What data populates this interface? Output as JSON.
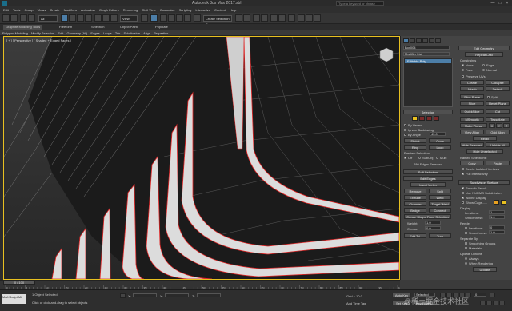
{
  "title_bar": {
    "title": "Autodesk 3ds Max 2017.sbl",
    "extra": "Type a keyword or phrase",
    "window_controls": [
      "—",
      "□",
      "×"
    ]
  },
  "menu": [
    "Edit",
    "Tools",
    "Group",
    "Views",
    "Create",
    "Modifiers",
    "Animation",
    "Graph Editors",
    "Rendering",
    "Civil View",
    "Customize",
    "Scripting",
    "Interactive",
    "Content",
    "Help"
  ],
  "main_toolbar": {
    "selection_filter": "All",
    "reference_coord": "View",
    "named_set": "Create Selection Se"
  },
  "ribbon_tabs": [
    {
      "label": "Graphite Modeling Tools",
      "active": true
    },
    {
      "label": "Freeform",
      "active": false
    },
    {
      "label": "Selection",
      "active": false
    },
    {
      "label": "Object Paint",
      "active": false
    },
    {
      "label": "Populate",
      "active": false
    }
  ],
  "ribbon_items": [
    "Polygon Modeling",
    "Modify Selection",
    "Edit",
    "Geometry (All)",
    "Edges",
    "Loops",
    "Tris",
    "Subdivision",
    "Align",
    "Properties"
  ],
  "viewport": {
    "label": "[ + ] [ Perspective ] [ Shaded + Edged Faces ]"
  },
  "command_panel": {
    "object_name": "Box004",
    "modifier_list": "Modifier List",
    "stack_item": "Editable Poly",
    "selection": {
      "title": "Selection",
      "by_vertex": "By Vertex",
      "ignore_backfacing": "Ignore Backfacing",
      "by_angle": "By Angle",
      "by_angle_value": "45.0",
      "shrink": "Shrink",
      "grow": "Grow",
      "ring": "Ring",
      "loop": "Loop",
      "preview_title": "Preview Selection",
      "preview_off": "Off",
      "preview_subobj": "SubObj",
      "preview_multi": "Multi",
      "status": "280 Edges Selected"
    },
    "soft_selection": {
      "title": "Soft Selection"
    },
    "edit_edges": {
      "title": "Edit Edges",
      "insert_vertex": "Insert Vertex",
      "remove": "Remove",
      "split": "Split",
      "extrude": "Extrude",
      "weld": "Weld",
      "chamfer": "Chamfer",
      "target_weld": "Target Weld",
      "bridge": "Bridge",
      "connect": "Connect",
      "create_shape": "Create Shape From Selection",
      "weight_label": "Weight:",
      "weight": "1.0",
      "crease_label": "Crease:",
      "crease": "0.0",
      "edit_tri": "Edit Tri.",
      "turn": "Turn"
    },
    "edit_geometry": {
      "title": "Edit Geometry",
      "repeat_last": "Repeat Last",
      "constraints": "Constraints",
      "none": "None",
      "edge": "Edge",
      "face": "Face",
      "normal": "Normal",
      "preserve_uvs": "Preserve UVs",
      "create": "Create",
      "collapse": "Collapse",
      "attach": "Attach",
      "detach": "Detach",
      "slice_plane": "Slice Plane",
      "split": "Split",
      "slice": "Slice",
      "reset_plane": "Reset Plane",
      "quickslice": "QuickSlice",
      "cut": "Cut",
      "msmooth": "MSmooth",
      "tessellate": "Tessellate",
      "make_planar": "Make Planar",
      "x": "X",
      "y": "Y",
      "z": "Z",
      "view_align": "View Align",
      "grid_align": "Grid Align",
      "relax": "Relax",
      "hide_selected": "Hide Selected",
      "unhide_all": "Unhide All",
      "hide_unselected": "Hide Unselected",
      "named_selections": "Named Selections:",
      "copy": "Copy",
      "paste": "Paste",
      "delete_isolated": "Delete Isolated Vertices",
      "full_interactivity": "Full Interactivity"
    },
    "subdivision_surface": {
      "title": "Subdivision Surface",
      "smooth_result": "Smooth Result",
      "use_nurms": "Use NURMS Subdivision",
      "isoline_display": "Isoline Display",
      "show_cage": "Show Cage......",
      "display": "Display",
      "iterations_label": "Iterations:",
      "iterations": "1",
      "smoothness_label": "Smoothness:",
      "smoothness": "1.0",
      "render": "Render",
      "render_iterations": "0",
      "render_smoothness": "1.0",
      "separate_by": "Separate By",
      "smoothing_groups": "Smoothing Groups",
      "materials": "Materials",
      "update_options": "Update Options",
      "always": "Always",
      "when_rendering": "When Rendering",
      "update": "Update"
    }
  },
  "timeline": {
    "slider": "0 / 100",
    "ticks": [
      "0",
      "5",
      "10",
      "15",
      "20",
      "25",
      "30",
      "35",
      "40",
      "45",
      "50",
      "55",
      "60",
      "65",
      "70",
      "75",
      "80",
      "85",
      "90",
      "95",
      "100"
    ]
  },
  "status": {
    "script_label": "MAXScript Mi",
    "objects_selected": "1 Object Selected",
    "prompt": "Click or click-and-drag to select objects",
    "x_label": "X:",
    "y_label": "Y:",
    "z_label": "Z:",
    "grid": "Grid = 10.0",
    "add_time_tag": "Add Time Tag",
    "auto_key": "Auto Key",
    "set_key": "Set Key",
    "key_filters": "Key Filters...",
    "selected": "Selected",
    "frame": "0"
  },
  "watermark": "@稀土掘金技术社区",
  "colors": {
    "viewport_border": "#e8c020",
    "panel_bg": "#444444",
    "mesh_face": "#1b1b1b",
    "edge_selected": "#e02828",
    "edge_normal": "#cfcfcf",
    "accent_blue": "#4c7ea8"
  }
}
